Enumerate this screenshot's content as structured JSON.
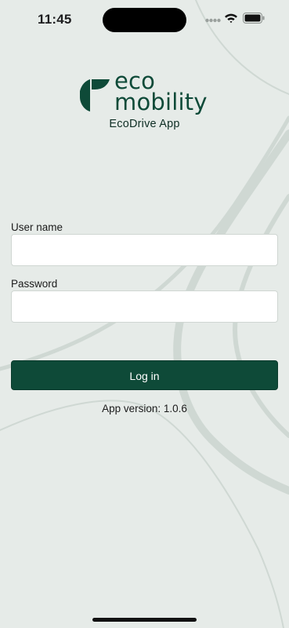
{
  "status_bar": {
    "time": "11:45",
    "icons": [
      "signal-dots-icon",
      "wifi-icon",
      "battery-icon"
    ]
  },
  "logo": {
    "line1": "eco",
    "line2": "mobility",
    "brand_color": "#0e4a38"
  },
  "app_name": "EcoDrive App",
  "form": {
    "username_label": "User name",
    "username_value": "",
    "password_label": "Password",
    "password_value": "",
    "login_label": "Log in"
  },
  "footer": {
    "version_text": "App version: 1.0.6"
  },
  "colors": {
    "background": "#e6ebe8",
    "accent": "#0e4a38"
  }
}
